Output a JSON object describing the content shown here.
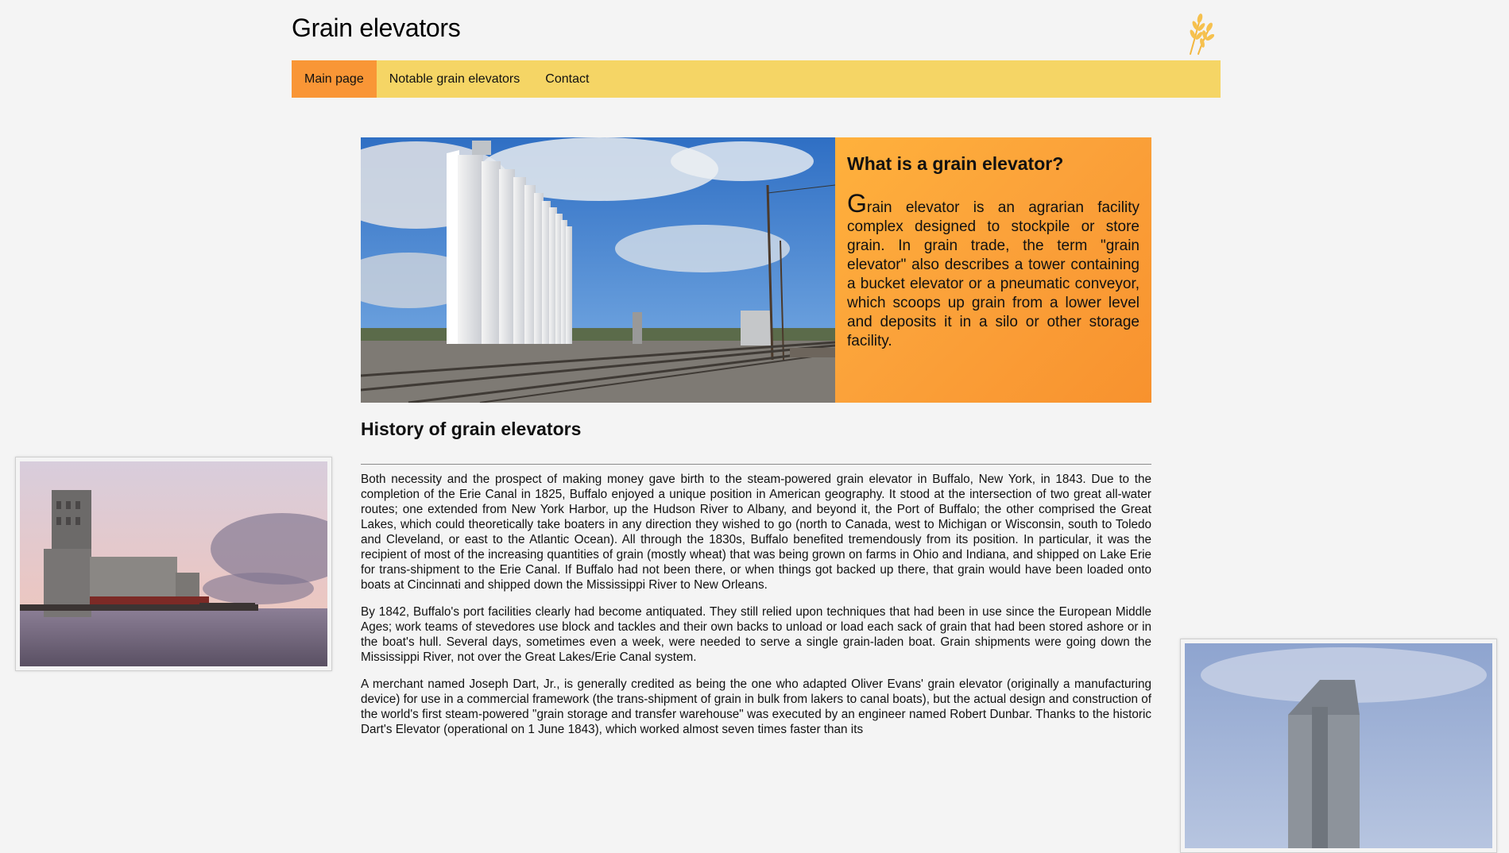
{
  "site": {
    "title": "Grain elevators",
    "logo_icon": "wheat-icon",
    "colors": {
      "background": "#f4f4f4",
      "nav_bar": "#f5d565",
      "nav_active": "#f99636",
      "hero_gradient_start": "#ffb13c",
      "hero_gradient_end": "#f8922e"
    }
  },
  "nav": {
    "items": [
      {
        "label": "Main page",
        "active": true
      },
      {
        "label": "Notable grain elevators",
        "active": false
      },
      {
        "label": "Contact",
        "active": false
      }
    ]
  },
  "hero": {
    "image_alt": "Concrete grain elevator beside railroad tracks",
    "heading": "What is a grain elevator?",
    "dropcap": "G",
    "body": "rain elevator is an agrarian facility complex designed to stockpile or store grain. In grain trade, the term \"grain elevator\" also describes a tower containing a bucket elevator or a pneumatic conveyor, which scoops up grain from a lower level and deposits it in a silo or other storage facility."
  },
  "history": {
    "heading": "History of grain elevators",
    "paragraphs": [
      "Both necessity and the prospect of making money gave birth to the steam-powered grain elevator in Buffalo, New York, in 1843. Due to the completion of the Erie Canal in 1825, Buffalo enjoyed a unique position in American geography. It stood at the intersection of two great all-water routes; one extended from New York Harbor, up the Hudson River to Albany, and beyond it, the Port of Buffalo; the other comprised the Great Lakes, which could theoretically take boaters in any direction they wished to go (north to Canada, west to Michigan or Wisconsin, south to Toledo and Cleveland, or east to the Atlantic Ocean). All through the 1830s, Buffalo benefited tremendously from its position. In particular, it was the recipient of most of the increasing quantities of grain (mostly wheat) that was being grown on farms in Ohio and Indiana, and shipped on Lake Erie for trans-shipment to the Erie Canal. If Buffalo had not been there, or when things got backed up there, that grain would have been loaded onto boats at Cincinnati and shipped down the Mississippi River to New Orleans.",
      "By 1842, Buffalo's port facilities clearly had become antiquated. They still relied upon techniques that had been in use since the European Middle Ages; work teams of stevedores use block and tackles and their own backs to unload or load each sack of grain that had been stored ashore or in the boat's hull. Several days, sometimes even a week, were needed to serve a single grain-laden boat. Grain shipments were going down the Mississippi River, not over the Great Lakes/Erie Canal system.",
      "A merchant named Joseph Dart, Jr., is generally credited as being the one who adapted Oliver Evans' grain elevator (originally a manufacturing device) for use in a commercial framework (the trans-shipment of grain in bulk from lakers to canal boats), but the actual design and construction of the world's first steam-powered \"grain storage and transfer warehouse\" was executed by an engineer named Robert Dunbar. Thanks to the historic Dart's Elevator (operational on 1 June 1843), which worked almost seven times faster than its"
    ]
  },
  "side_images": {
    "left_alt": "Abandoned grain elevator on a lakeshore at dusk",
    "right_alt": "Wooden grain elevator against a cloudy sky"
  }
}
